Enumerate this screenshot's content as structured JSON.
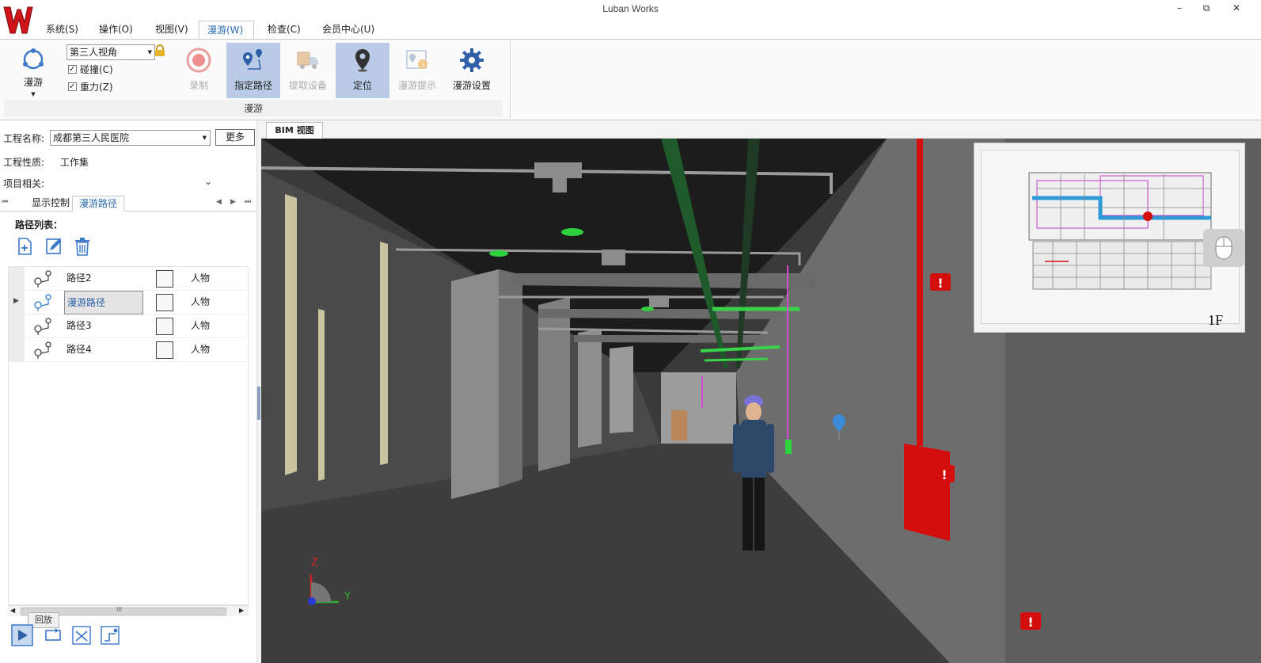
{
  "window": {
    "title": "Luban Works",
    "controls": [
      "–",
      "⧉",
      "✕"
    ]
  },
  "menu": {
    "items": [
      "系统(S)",
      "操作(O)",
      "视图(V)",
      "漫游(W)",
      "检查(C)",
      "会员中心(U)"
    ],
    "active": "漫游(W)"
  },
  "ribbon": {
    "group_label": "漫游",
    "roam_button": "漫游",
    "view_mode": "第三人视角",
    "collision_label": "碰撞(C)",
    "gravity_label": "重力(Z)",
    "buttons": {
      "record": "录制",
      "set_path": "指定路径",
      "extract_device": "提取设备",
      "locate": "定位",
      "roam_hint": "漫游提示",
      "roam_settings": "漫游设置"
    }
  },
  "left_panel": {
    "project_name_label": "工程名称:",
    "project_name_value": "成都第三人民医院",
    "more_button": "更多",
    "project_type_label": "工程性质:",
    "project_type_value": "工作集",
    "project_related_label": "项目相关:",
    "tabs": [
      "显示控制",
      "漫游路径"
    ],
    "active_tab": "漫游路径",
    "route_list_label": "路径列表：",
    "routes": [
      {
        "name": "路径2",
        "kind": "人物"
      },
      {
        "name": "漫游路径",
        "kind": "人物"
      },
      {
        "name": "路径3",
        "kind": "人物"
      },
      {
        "name": "路径4",
        "kind": "人物"
      }
    ],
    "scroll_grip": "III",
    "tooltip": "回放"
  },
  "bim": {
    "tab_label": "BIM 视图",
    "floor_label": "1F",
    "axis_z": "Z",
    "axis_y": "Y"
  },
  "colors": {
    "accent": "#2b6cb0",
    "selected_button": "#b9cbe6",
    "fire_red": "#d40d0d",
    "pipe_green": "#2ecc40",
    "logo_red": "#d0141a"
  }
}
